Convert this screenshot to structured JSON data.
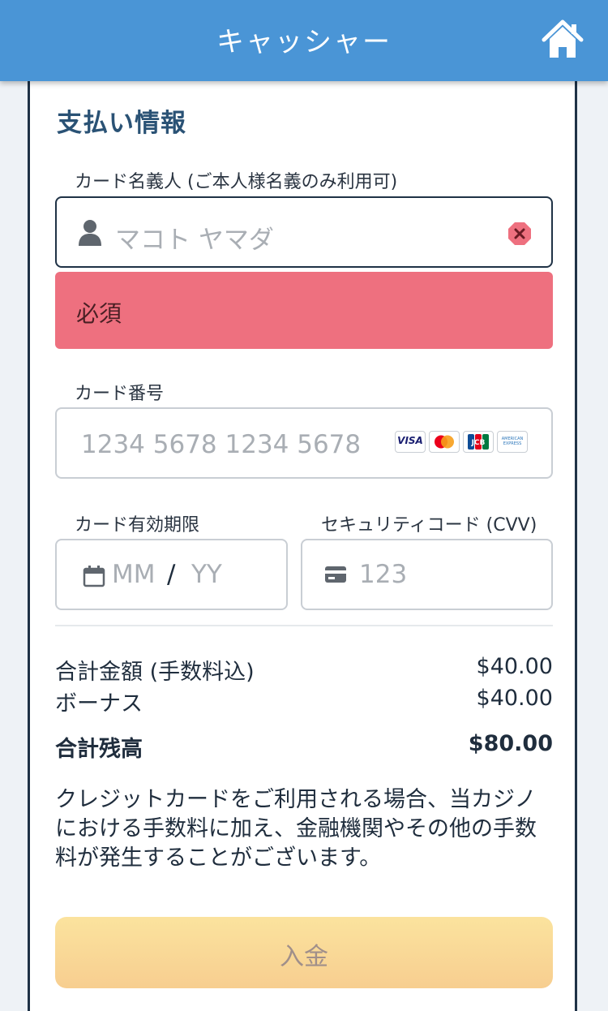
{
  "header": {
    "title": "キャッシャー",
    "home_icon": "home-icon"
  },
  "form": {
    "section_title": "支払い情報",
    "cardholder": {
      "label": "カード名義人 (ご本人様名義のみ利用可)",
      "placeholder": "マコト ヤマダ",
      "error": "必須",
      "icon": "user-icon",
      "clear_icon": "clear-icon"
    },
    "card_number": {
      "label": "カード番号",
      "placeholder": "1234 5678 1234 5678",
      "brands": [
        "VISA",
        "Mastercard",
        "JCB",
        "AMERICAN EXPRESS"
      ]
    },
    "expiry": {
      "label": "カード有効期限",
      "placeholder_month": "MM",
      "separator": "/",
      "placeholder_year": "YY",
      "icon": "calendar-icon"
    },
    "cvv": {
      "label": "セキュリティコード (CVV)",
      "placeholder": "123",
      "icon": "card-icon"
    }
  },
  "summary": {
    "rows": [
      {
        "label": "合計金額 (手数料込)",
        "value": "$40.00"
      },
      {
        "label": "ボーナス",
        "value": "$40.00"
      }
    ],
    "total": {
      "label": "合計残高",
      "value": "$80.00"
    }
  },
  "notice": "クレジットカードをご利用される場合、当カジノにおける手数料に加え、金融機関やその他の手数料が発生することがございます。",
  "deposit_button": "入金",
  "colors": {
    "header": "#4a95d6",
    "error": "#ee707f",
    "title": "#2a5275",
    "button": "#f9d896"
  }
}
